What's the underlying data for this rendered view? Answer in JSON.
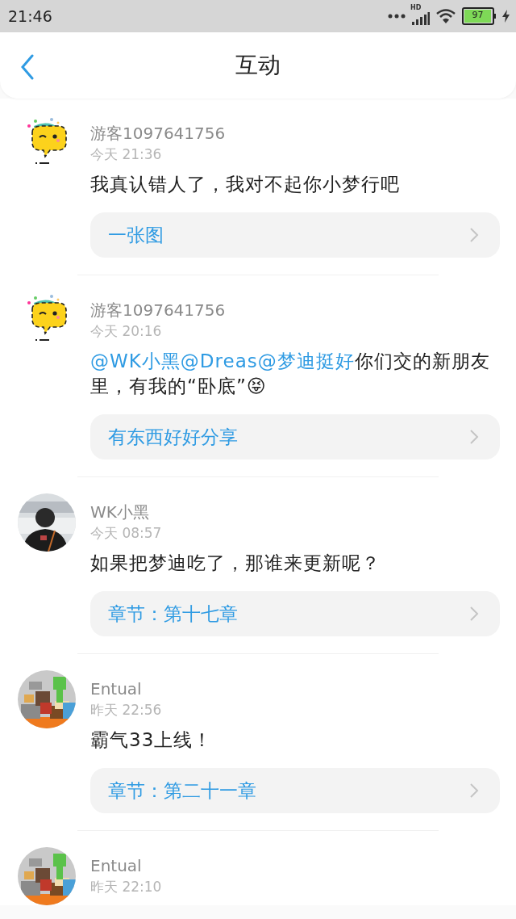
{
  "status_bar": {
    "time": "21:46",
    "network": "HD",
    "battery": "97"
  },
  "header": {
    "title": "互动"
  },
  "items": [
    {
      "avatar": {
        "kind": "bubble"
      },
      "name": "游客1097641756",
      "time": "今天 21:36",
      "comment": {
        "text": "我真认错人了，我对不起你小梦行吧"
      },
      "link": "一张图"
    },
    {
      "avatar": {
        "kind": "bubble"
      },
      "name": "游客1097641756",
      "time": "今天 20:16",
      "comment": {
        "mentions": [
          "@WK小黑",
          "@Dreas",
          "@梦迪挺好"
        ],
        "text": "你们交的新朋友里，有我的“卧底”😝"
      },
      "link": "有东西好好分享"
    },
    {
      "avatar": {
        "kind": "person"
      },
      "name": "WK小黑",
      "time": "今天 08:57",
      "comment": {
        "text": "如果把梦迪吃了，那谁来更新呢？"
      },
      "link": "章节：第十七章"
    },
    {
      "avatar": {
        "kind": "game"
      },
      "name": "Entual",
      "time": "昨天 22:56",
      "comment": {
        "text": "霸气33上线！"
      },
      "link": "章节：第二十一章"
    },
    {
      "avatar": {
        "kind": "game"
      },
      "name": "Entual",
      "time": "昨天 22:10"
    }
  ]
}
